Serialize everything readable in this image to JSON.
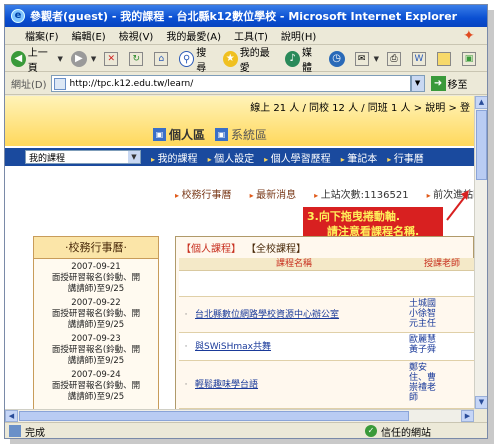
{
  "window": {
    "title": "參觀者(guest) - 我的課程 - 台北縣k12數位學校 - Microsoft Internet Explorer"
  },
  "menu": [
    "檔案(F)",
    "編輯(E)",
    "檢視(V)",
    "我的最愛(A)",
    "工具(T)",
    "說明(H)"
  ],
  "toolbar": {
    "back": "上一頁",
    "search": "搜尋",
    "favorites": "我的最愛",
    "media": "媒體"
  },
  "address": {
    "label": "網址(D)",
    "url": "http://tpc.k12.edu.tw/learn/",
    "go": "移至"
  },
  "site": {
    "online_info": "線上 21 人 / 同校 12 人 / 同班 1 人 > 說明 > 登",
    "zone_personal": "個人區",
    "zone_system": "系統區",
    "nav_select": "我的課程",
    "nav_items": [
      "我的課程",
      "個人設定",
      "個人學習歷程",
      "筆記本",
      "行事曆"
    ],
    "links": [
      "校務行事曆",
      "最新消息",
      "上站次數:1136521",
      "前次進站時"
    ]
  },
  "annotation": {
    "line1": "3.向下拖曳捲動軸.",
    "line2": "請注意看課程名稱."
  },
  "calendar": {
    "title": "‧校務行事曆‧",
    "events": [
      {
        "date": "2007-09-21",
        "l1": "面授研習報名(鈴動、開",
        "l2": "講請師)至9/25"
      },
      {
        "date": "2007-09-22",
        "l1": "面授研習報名(鈴動、開",
        "l2": "講請師)至9/25"
      },
      {
        "date": "2007-09-23",
        "l1": "面授研習報名(鈴動、開",
        "l2": "講請師)至9/25"
      },
      {
        "date": "2007-09-24",
        "l1": "面授研習報名(鈴動、開",
        "l2": "講請師)至9/25"
      }
    ]
  },
  "courses": {
    "tab_personal": "【個人課程】",
    "tab_all": "【全校課程】",
    "col_name": "課程名稱",
    "col_teacher": "授課老師",
    "rows": [
      {
        "name": "",
        "teacher": ""
      },
      {
        "name": "台北縣數位網路學校資源中心辦公室",
        "teacher": "土城國\n小徐智\n元主任"
      },
      {
        "name": "與SWiSHmax共舞",
        "teacher": "歐麗慧\n黃子舜"
      },
      {
        "name": "輕鬆趣味學台語",
        "teacher": "鄭安\n住、曹\n崇禮老\n師"
      }
    ]
  },
  "status": {
    "done": "完成",
    "zone": "信任的網站"
  }
}
